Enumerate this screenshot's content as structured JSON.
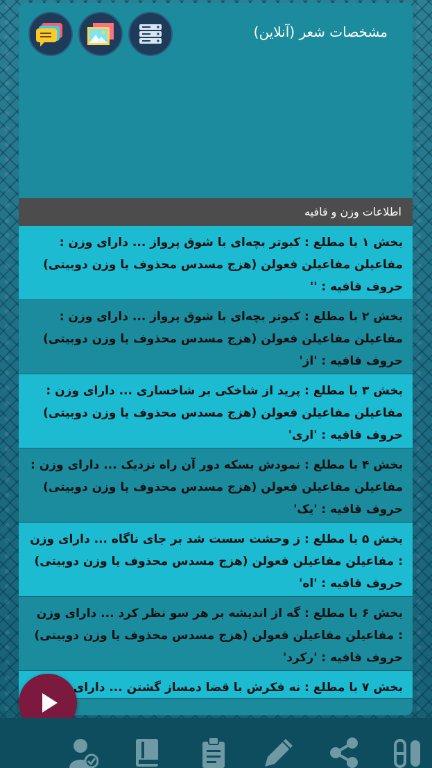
{
  "header": {
    "title": "مشخصات شعر (آنلاین)",
    "icons": [
      "server-list-icon",
      "gallery-icon",
      "chat-messages-icon"
    ]
  },
  "section": {
    "title": "اطلاعات وزن و قافیه"
  },
  "rows": [
    {
      "text": "بخش ۱ با مطلع : کبوتر بچه‌ای با شوق پرواز ... دارای وزن : مفاعیلن مفاعیلن فعولن (هزج مسدس محذوف یا وزن دوبیتی) حروف قافیه : ''"
    },
    {
      "text": "بخش ۲ با مطلع : کبوتر بچه‌ای با شوق پرواز ... دارای وزن : مفاعیلن مفاعیلن فعولن (هزج مسدس محذوف یا وزن دوبیتی) حروف قافیه : 'از'"
    },
    {
      "text": "بخش ۳ با مطلع : پرید از شاخکی بر شاخساری ... دارای وزن : مفاعیلن مفاعیلن فعولن (هزج مسدس محذوف یا وزن دوبیتی) حروف قافیه : 'اری'"
    },
    {
      "text": "بخش ۴ با مطلع : نمودش بسکه دور آن راه نزدیک ... دارای وزن : مفاعیلن مفاعیلن فعولن (هزج مسدس محذوف یا وزن دوبیتی) حروف قافیه : 'یک'"
    },
    {
      "text": "بخش ۵ با مطلع : ز وحشت سست شد بر جای ناگاه ... دارای وزن : مفاعیلن مفاعیلن فعولن (هزج مسدس محذوف یا وزن دوبیتی) حروف قافیه : 'اه'"
    },
    {
      "text": "بخش ۶ با مطلع : گه از اندیشه بر هر سو نظر کرد ... دارای وزن : مفاعیلن مفاعیلن فعولن (هزج مسدس محذوف یا وزن دوبیتی) حروف قافیه : 'رکرد'"
    },
    {
      "text": "بخش ۷ با مطلع : نه فکرش با قضا دمساز گشتن ... دارای"
    }
  ],
  "player": {
    "icon": "play-icon"
  },
  "bottom_nav": [
    "user-check-icon",
    "book-icon",
    "clipboard-icon",
    "pen-icon",
    "share-icon",
    "pills-icon"
  ],
  "colors": {
    "accent_play": "#7b1a3e",
    "row_light": "#1dbbd2",
    "row_dark": "#1a8c9e",
    "section_bar": "#4c4c4c",
    "bottom_bar": "#0e4d5e"
  }
}
